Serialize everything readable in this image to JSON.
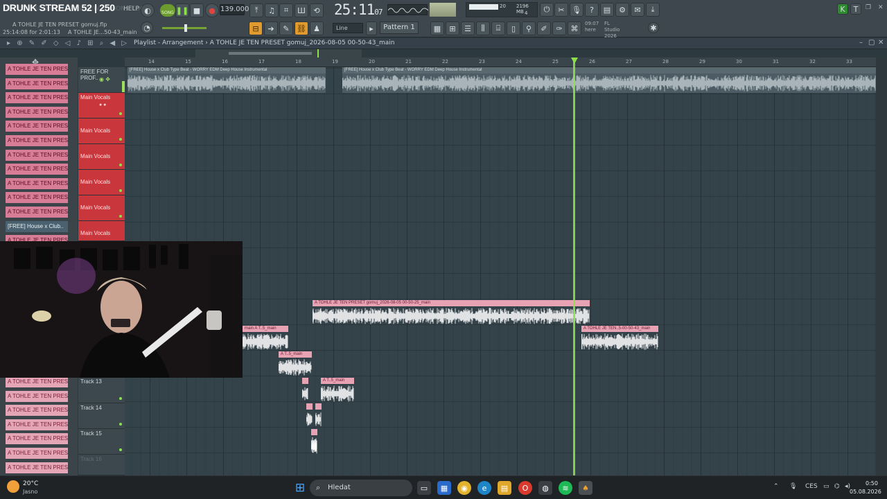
{
  "window": {
    "stream_title": "DRUNK STREAM 52 | 250",
    "menu_faint": "FILE EDIT ADD PATTERNS VIEW OPTIONS TOOLS",
    "menu_help": "HELP",
    "file_name": "A TOHLE JE TEN PRESET gomuj.flp",
    "file_time": "25:14:08 for 2:01:13",
    "file_tag": "A TOHLE JE...50-43_main"
  },
  "transport": {
    "song_label": "SONG",
    "tempo": "139.000",
    "time_main": "25:11",
    "time_sub": "07",
    "cpu_value": "20",
    "ram_value": "2196 MB",
    "voices": "4",
    "line_mode": "Line",
    "pattern": "Pattern 1",
    "news_time": "09:07",
    "news_line1": "FL Studio 2026 is",
    "news_line2": "here"
  },
  "playlist": {
    "header_title": "Playlist - Arrangement",
    "header_song": "A TOHLE JE TEN PRESET gomuj_2026-08-05 00-50-43_main",
    "ruler_numbers": [
      "14",
      "15",
      "16",
      "17",
      "18",
      "19",
      "20",
      "21",
      "22",
      "23",
      "24",
      "25",
      "26",
      "27",
      "28",
      "29",
      "30",
      "31",
      "32",
      "33"
    ]
  },
  "picker": {
    "items": [
      "A TOHLE JE TEN PRESET g..",
      "A TOHLE JE TEN PRESET g..",
      "A TOHLE JE TEN PRESET g..",
      "A TOHLE JE TEN PRESET g..",
      "A TOHLE JE TEN PRESET g..",
      "A TOHLE JE TEN PRESET g..",
      "A TOHLE JE TEN PRESET g..",
      "A TOHLE JE TEN PRESET g..",
      "A TOHLE JE TEN PRESET g..",
      "A TOHLE JE TEN PRESET g..",
      "A TOHLE JE TEN PRESET g..",
      "[FREE] House x Club..",
      "A TOHLE JE TEN PRESET g.."
    ],
    "items_lower": [
      "A TOHLE JE TEN PRESET g..",
      "A TOHLE JE TEN PRESET g..",
      "A TOHLE JE TEN PRESET g..",
      "A TOHLE JE TEN PRESET g..",
      "A TOHLE JE TEN PRESET g..",
      "A TOHLE JE TEN PRESET g..",
      "A TOHLE JE TEN PRESET g.."
    ]
  },
  "tracks": {
    "t1": "FREE FOR PROF..",
    "t2": "Main Vocals",
    "t3": "Main Vocals",
    "t4": "Main Vocals",
    "t5": "Main Vocals",
    "t6": "Main Vocals",
    "t7": "Main Vocals",
    "t13": "Track 13",
    "t14": "Track 14",
    "t15": "Track 15",
    "t16": "Track 16"
  },
  "clips": {
    "beat1": "[FREE] House x Club Type Beat - WORRY  EDM Deep House Instrumental",
    "beat2": "[FREE] House x Club Type Beat - WORRY  EDM Deep House Instrumental",
    "vocal_big": "A TOHLE JE TEN PRESET gomuj_2026-08-05 00-50-25_main",
    "vocal_a": "main  A T..5_main",
    "vocal_b": "A T..5_main",
    "vocal_c": "A T..5_main",
    "vocal_right": "A TOHLE JE TEN..5-00-50-43_main"
  },
  "taskbar": {
    "weather_temp": "20°C",
    "weather_desc": "Jasno",
    "search_placeholder": "Hledat",
    "lang": "CES",
    "time": "0:50",
    "date": "05.08.2026"
  },
  "colors": {
    "accent_green": "#8ee04a",
    "clip_pink": "#e7a3b4",
    "track_red": "#c9363c"
  }
}
